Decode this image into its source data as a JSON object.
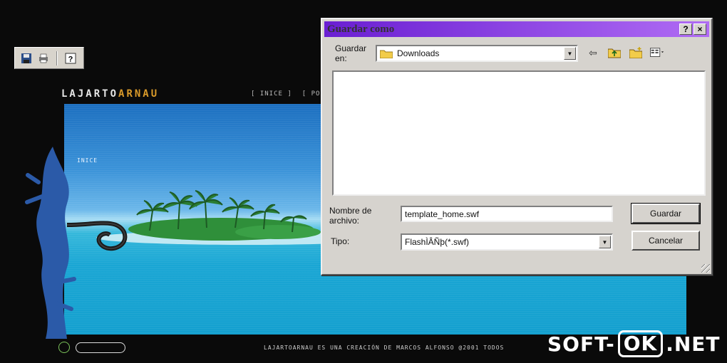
{
  "site": {
    "logo_main": "LAJARTO",
    "logo_accent": "ARNAU",
    "nav": [
      "[ INICE ]",
      "[ POR"
    ],
    "index_label": "INICE",
    "footer_text": "LAJARTOARNAU ES UNA CREACIÓN DE MARCOS ALFONSO @2001 TODOS"
  },
  "dialog": {
    "title": "Guardar como",
    "help_button": "?",
    "close_button": "×",
    "save_in_label": "Guardar en:",
    "save_in_value": "Downloads",
    "filename_label": "Nombre de archivo:",
    "filename_value": "template_home.swf",
    "type_label": "Tipo:",
    "type_value": "FlashÌÂÑþ(*.swf)",
    "save_button": "Guardar",
    "cancel_button": "Cancelar"
  },
  "watermark": {
    "prefix": "SOFT-",
    "boxed": "OK",
    "suffix": ".NET"
  },
  "colors": {
    "title_bar": "#6a1fd2",
    "dialog_face": "#d6d3ce",
    "logo_accent": "#d99a2a"
  }
}
